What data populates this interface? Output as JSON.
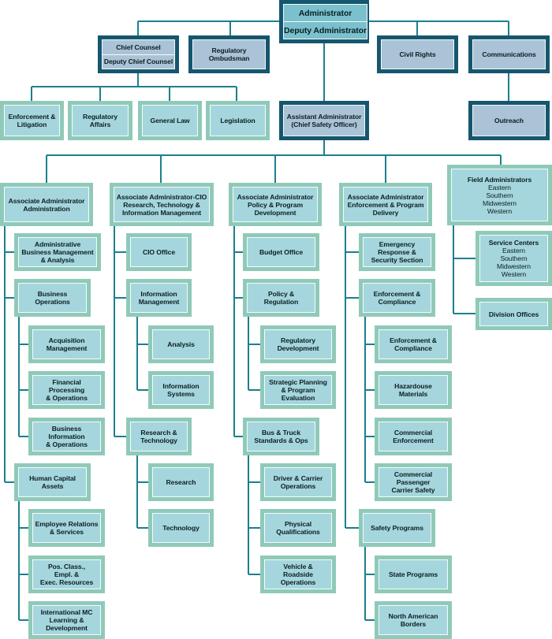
{
  "colors": {
    "connector": "#1c7f8e",
    "dark_frame": "#16566e",
    "teal_frame": "#8fcab9",
    "teal_fill": "#a6d6dd",
    "blue_fill": "#abc3d6"
  },
  "boxes": {
    "admin": {
      "lines": [
        "Administrator",
        "Deputy Administrator"
      ]
    },
    "chief_counsel": {
      "lines": [
        "Chief Counsel",
        "Deputy Chief Counsel"
      ]
    },
    "ombudsman": {
      "lines": [
        "Regulatory",
        "Ombudsman"
      ]
    },
    "civil_rights": {
      "lines": [
        "Civil Rights"
      ]
    },
    "communications": {
      "lines": [
        "Communications"
      ]
    },
    "enf_lit": {
      "lines": [
        "Enforcement &",
        "Litigation"
      ]
    },
    "reg_affairs": {
      "lines": [
        "Regulatory",
        "Affairs"
      ]
    },
    "general_law": {
      "lines": [
        "General Law"
      ]
    },
    "legislation": {
      "lines": [
        "Legislation"
      ]
    },
    "asst_admin": {
      "lines": [
        "Assistant Administrator",
        "(Chief Safety Officer)"
      ]
    },
    "outreach": {
      "lines": [
        "Outreach"
      ]
    },
    "aa_admin": {
      "lines": [
        "Associate Administrator",
        "Administration"
      ]
    },
    "aa_cio": {
      "lines": [
        "Associate Administrator-CIO",
        "Research, Technology &",
        "Information Management"
      ]
    },
    "aa_policy": {
      "lines": [
        "Associate Administrator",
        "Policy & Program",
        "Development"
      ]
    },
    "aa_enf": {
      "lines": [
        "Associate Administrator",
        "Enforcement & Program",
        "Delivery"
      ]
    },
    "field": {
      "lines": [
        "Field Administrators",
        "Eastern",
        "Southern",
        "Midwestern",
        "Western"
      ]
    },
    "admin_bma": {
      "lines": [
        "Administrative",
        "Business Management",
        "& Analysis"
      ]
    },
    "bus_ops": {
      "lines": [
        "Business",
        "Operations"
      ]
    },
    "acquisition": {
      "lines": [
        "Acquisition",
        "Management"
      ]
    },
    "financial": {
      "lines": [
        "Financial",
        "Processing",
        "& Operations"
      ]
    },
    "bus_info": {
      "lines": [
        "Business",
        "Information",
        "& Operations"
      ]
    },
    "hca": {
      "lines": [
        "Human Capital",
        "Assets"
      ]
    },
    "emp_rel": {
      "lines": [
        "Employee Relations",
        "& Services"
      ]
    },
    "pos_class": {
      "lines": [
        "Pos. Class.,",
        "Empl. &",
        "Exec. Resources"
      ]
    },
    "intl_mc": {
      "lines": [
        "International MC",
        "Learning &",
        "Development"
      ]
    },
    "cio_office": {
      "lines": [
        "CIO Office"
      ]
    },
    "info_mgmt": {
      "lines": [
        "Information",
        "Management"
      ]
    },
    "analysis": {
      "lines": [
        "Analysis"
      ]
    },
    "info_sys": {
      "lines": [
        "Information",
        "Systems"
      ]
    },
    "res_tech": {
      "lines": [
        "Research &",
        "Technology"
      ]
    },
    "research": {
      "lines": [
        "Research"
      ]
    },
    "technology": {
      "lines": [
        "Technology"
      ]
    },
    "budget": {
      "lines": [
        "Budget Office"
      ]
    },
    "policy_reg": {
      "lines": [
        "Policy &",
        "Regulation"
      ]
    },
    "reg_dev": {
      "lines": [
        "Regulatory",
        "Development"
      ]
    },
    "strat_plan": {
      "lines": [
        "Strategic Planning",
        "& Program",
        "Evaluation"
      ]
    },
    "bus_truck": {
      "lines": [
        "Bus & Truck",
        "Standards & Ops"
      ]
    },
    "driver": {
      "lines": [
        "Driver & Carrier",
        "Operations"
      ]
    },
    "physical": {
      "lines": [
        "Physical",
        "Qualifications"
      ]
    },
    "vehicle": {
      "lines": [
        "Vehicle &",
        "Roadside",
        "Operations"
      ]
    },
    "emergency": {
      "lines": [
        "Emergency",
        "Response &",
        "Security Section"
      ]
    },
    "enf_comp": {
      "lines": [
        "Enforcement &",
        "Compliance"
      ]
    },
    "enf_comp2": {
      "lines": [
        "Enforcement &",
        "Compliance"
      ]
    },
    "hazmat": {
      "lines": [
        "Hazardouse",
        "Materials"
      ]
    },
    "comm_enf": {
      "lines": [
        "Commercial",
        "Enforcement"
      ]
    },
    "comm_pass": {
      "lines": [
        "Commercial",
        "Passenger",
        "Carrier Safety"
      ]
    },
    "safety_prog": {
      "lines": [
        "Safety Programs"
      ]
    },
    "state_prog": {
      "lines": [
        "State Programs"
      ]
    },
    "na_borders": {
      "lines": [
        "North American",
        "Borders"
      ]
    },
    "service_centers": {
      "lines": [
        "Service Centers",
        "Eastern",
        "Southern",
        "Midwestern",
        "Western"
      ]
    },
    "division": {
      "lines": [
        "Division Offices"
      ]
    }
  }
}
